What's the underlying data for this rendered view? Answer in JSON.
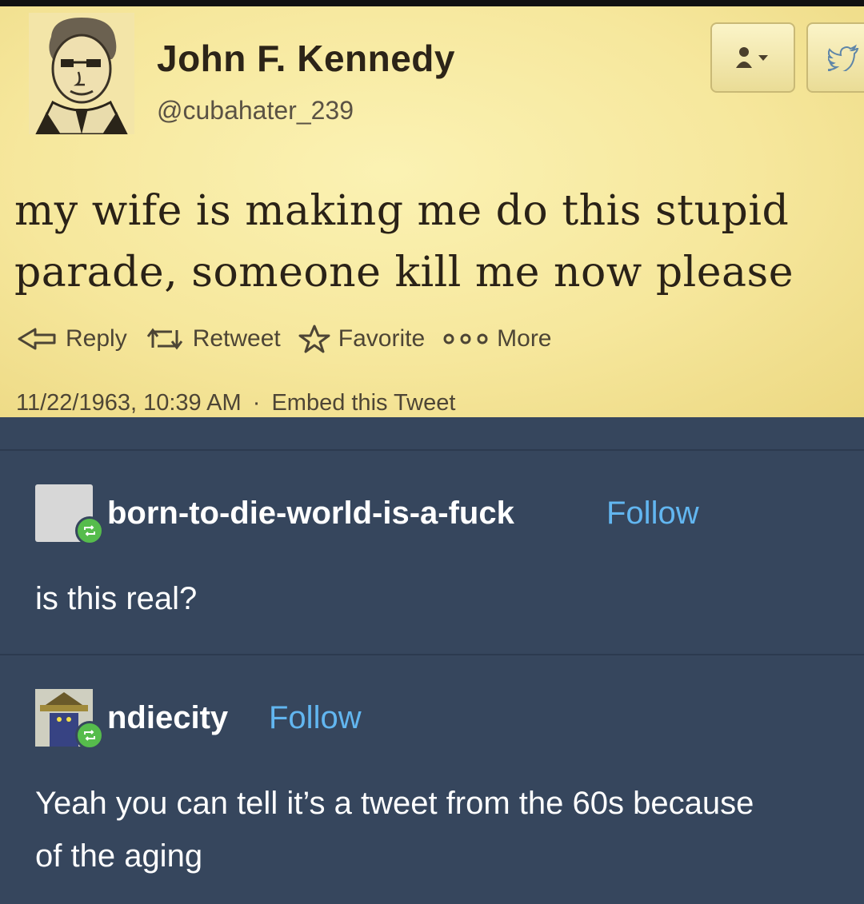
{
  "tweet": {
    "name": "John F. Kennedy",
    "handle": "@cubahater_239",
    "text": "my wife is making me do this stupid parade, someone kill me now please",
    "actions": {
      "reply": "Reply",
      "retweet": "Retweet",
      "favorite": "Favorite",
      "more": "More"
    },
    "timestamp": "11/22/1963, 10:39 AM",
    "separator": "·",
    "embed": "Embed this Tweet"
  },
  "comments": [
    {
      "username": "born-to-die-world-is-a-fuck",
      "follow": "Follow",
      "text": "is this real?"
    },
    {
      "username": "ndiecity",
      "follow": "Follow",
      "text": "Yeah you can tell it’s a tweet from the 60s because of the aging"
    }
  ],
  "colors": {
    "background": "#36465d",
    "tweet_background": "#f6e79c",
    "follow_link": "#62b6f0",
    "reblog_badge": "#56bc4c"
  },
  "icons": [
    "user-follow-icon",
    "twitter-bird-icon",
    "reply-icon",
    "retweet-icon",
    "star-icon",
    "more-dots-icon",
    "reblog-icon"
  ]
}
